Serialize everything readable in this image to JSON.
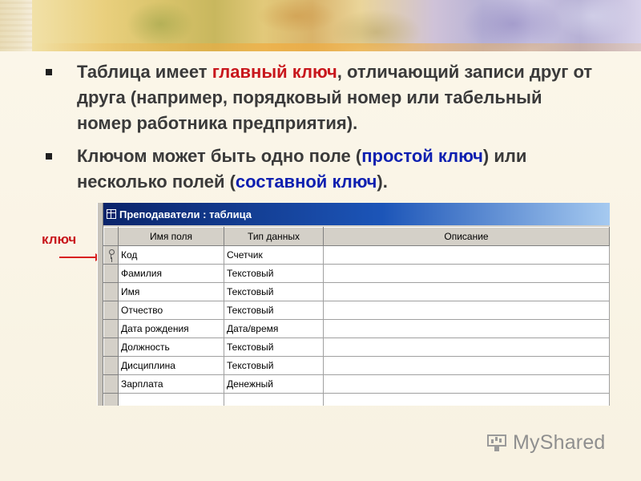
{
  "slide": {
    "bullets": [
      {
        "before": "Таблица имеет ",
        "highlight": "главный ключ",
        "after": ", отличающий записи друг от друга (например, порядковый номер или табельный номер работника предприятия)."
      },
      {
        "before": "Ключом может быть одно поле (",
        "highlight1": "простой ключ",
        "middle": ") или несколько полей (",
        "highlight2": "составной ключ",
        "after": ")."
      }
    ],
    "key_label": "ключ",
    "colors": {
      "highlight_red": "#c8161c",
      "highlight_blue": "#0d1fb0",
      "text": "#3a3a3a"
    }
  },
  "window": {
    "title": "Преподаватели : таблица",
    "icon": "table-icon",
    "columns": [
      "Имя поля",
      "Тип данных",
      "Описание"
    ],
    "rows": [
      {
        "field": "Код",
        "type": "Счетчик",
        "primary_key": true
      },
      {
        "field": "Фамилия",
        "type": "Текстовый"
      },
      {
        "field": "Имя",
        "type": "Текстовый"
      },
      {
        "field": "Отчество",
        "type": "Текстовый"
      },
      {
        "field": "Дата рождения",
        "type": "Дата/время"
      },
      {
        "field": "Должность",
        "type": "Текстовый"
      },
      {
        "field": "Дисциплина",
        "type": "Текстовый"
      },
      {
        "field": "Зарплата",
        "type": "Денежный"
      },
      {
        "field": "",
        "type": ""
      }
    ]
  },
  "watermark": {
    "text": "MyShared",
    "icon": "presentation-screen-icon"
  }
}
